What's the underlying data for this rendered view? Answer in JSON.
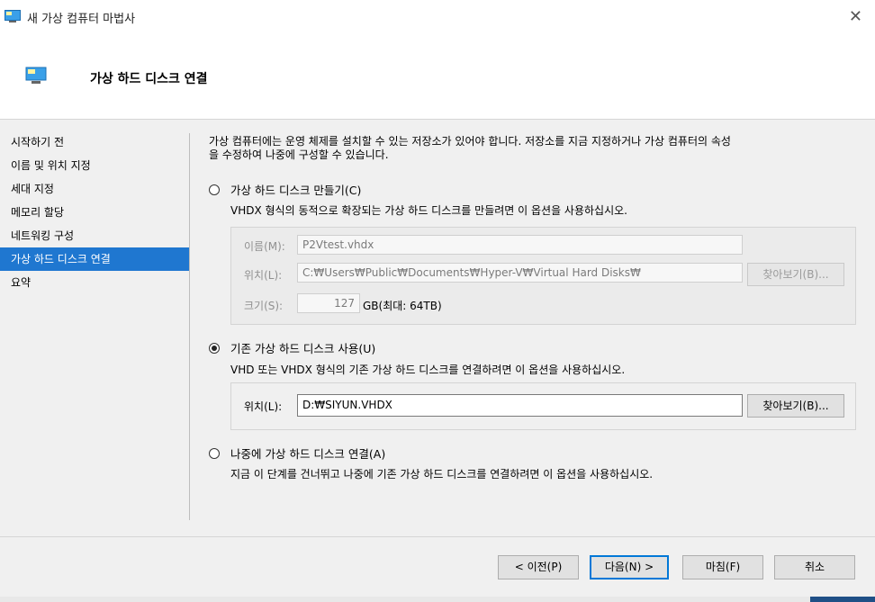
{
  "window": {
    "title": "새 가상 컴퓨터 마법사"
  },
  "header": {
    "title": "가상 하드 디스크 연결"
  },
  "sidebar": {
    "items": [
      {
        "label": "시작하기 전",
        "active": false
      },
      {
        "label": "이름 및 위치 지정",
        "active": false
      },
      {
        "label": "세대 지정",
        "active": false
      },
      {
        "label": "메모리 할당",
        "active": false
      },
      {
        "label": "네트워킹 구성",
        "active": false
      },
      {
        "label": "가상 하드 디스크 연결",
        "active": true
      },
      {
        "label": "요약",
        "active": false
      }
    ]
  },
  "main": {
    "description_line1": "가상 컴퓨터에는 운영 체제를 설치할 수 있는 저장소가 있어야 합니다. 저장소를 지금 지정하거나 가상 컴퓨터의 속성",
    "description_line2": "을 수정하여 나중에 구성할 수 있습니다.",
    "option_create": {
      "label": "가상 하드 디스크 만들기(C)",
      "hint": "VHDX 형식의 동적으로 확장되는 가상 하드 디스크를 만들려면 이 옵션을 사용하십시오.",
      "selected": false,
      "name_label": "이름(M):",
      "name_value": "P2Vtest.vhdx",
      "location_label": "위치(L):",
      "location_value": "C:₩Users₩Public₩Documents₩Hyper-V₩Virtual Hard Disks₩",
      "browse_label": "찾아보기(B)...",
      "size_label": "크기(S):",
      "size_value": "127",
      "size_unit": "GB(최대: 64TB)"
    },
    "option_existing": {
      "label": "기존 가상 하드 디스크 사용(U)",
      "hint": "VHD 또는 VHDX 형식의 기존 가상 하드 디스크를 연결하려면 이 옵션을 사용하십시오.",
      "selected": true,
      "location_label": "위치(L):",
      "location_value": "D:₩SIYUN.VHDX",
      "browse_label": "찾아보기(B)..."
    },
    "option_later": {
      "label": "나중에 가상 하드 디스크 연결(A)",
      "hint": "지금 이 단계를 건너뛰고 나중에 기존 가상 하드 디스크를 연결하려면 이 옵션을 사용하십시오.",
      "selected": false
    }
  },
  "footer": {
    "prev_label": "< 이전(P)",
    "next_label": "다음(N) >",
    "finish_label": "마침(F)",
    "cancel_label": "취소"
  },
  "colors": {
    "accent": "#1f77d0",
    "button_focus": "#0078d7"
  }
}
